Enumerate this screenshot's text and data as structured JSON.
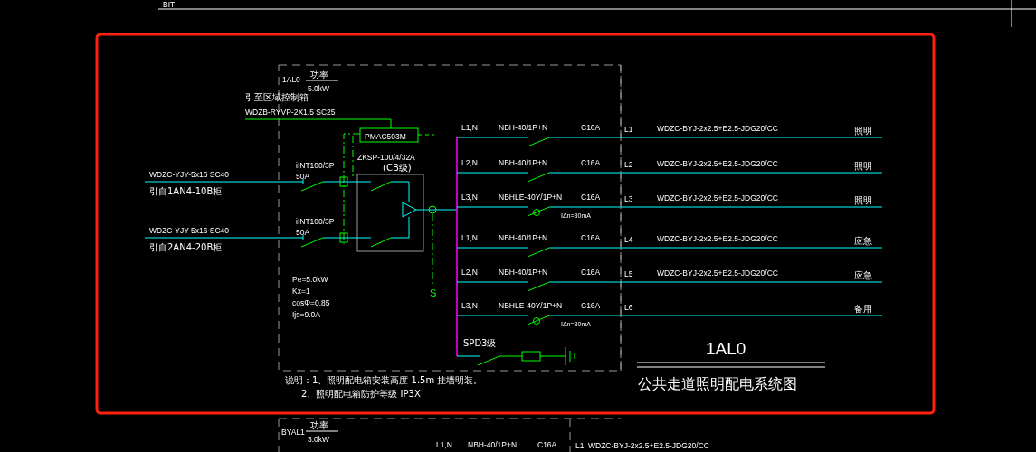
{
  "top_label": "BIT",
  "panel": {
    "name": "1AL0",
    "load_label": "功率",
    "load": "5.0kW",
    "control_note": "引至区域控制箱",
    "control_cable": "WDZB-RYVP-2X1.5 SC25",
    "meter": "PMAC503M",
    "ats": "ZKSP-100/4/32A",
    "ats_class": "(CB级)",
    "s_label": "S"
  },
  "inputs": [
    {
      "cable": "WDZC-YJY-5x16 SC40",
      "source": "引自1AN4-10B柜",
      "breaker": "iINT100/3P",
      "rating": "50A"
    },
    {
      "cable": "WDZC-YJY-5x16 SC40",
      "source": "引自2AN4-20B柜",
      "breaker": "iINT100/3P",
      "rating": "50A"
    }
  ],
  "circuits": [
    {
      "phase": "L1,N",
      "breaker": "NBH-40/1P+N",
      "rating": "C16A",
      "rcd": false,
      "line": "L1",
      "cable": "WDZC-BYJ-2x2.5+E2.5-JDG20/CC",
      "use": "照明"
    },
    {
      "phase": "L2,N",
      "breaker": "NBH-40/1P+N",
      "rating": "C16A",
      "rcd": false,
      "line": "L2",
      "cable": "WDZC-BYJ-2x2.5+E2.5-JDG20/CC",
      "use": "照明"
    },
    {
      "phase": "L3,N",
      "breaker": "NBHLE-40Y/1P+N",
      "rating": "C16A",
      "rcd": true,
      "rcd_label": "IΔn=30mA",
      "line": "L3",
      "cable": "WDZC-BYJ-2x2.5+E2.5-JDG20/CC",
      "use": "照明"
    },
    {
      "phase": "L1,N",
      "breaker": "NBH-40/1P+N",
      "rating": "C16A",
      "rcd": false,
      "line": "L4",
      "cable": "WDZC-BYJ-2x2.5+E2.5-JDG20/CC",
      "use": "应急"
    },
    {
      "phase": "L2,N",
      "breaker": "NBH-40/1P+N",
      "rating": "C16A",
      "rcd": false,
      "line": "L5",
      "cable": "WDZC-BYJ-2x2.5+E2.5-JDG20/CC",
      "use": "应急"
    },
    {
      "phase": "L3,N",
      "breaker": "NBHLE-40Y/1P+N",
      "rating": "C16A",
      "rcd": true,
      "rcd_label": "IΔn=30mA",
      "line": "L6",
      "use": "备用"
    }
  ],
  "spd": "SPD3级",
  "calc": [
    "Pe=5.0kW",
    "Kx=1",
    "cosΦ=0.85",
    "Ijs=9.0A"
  ],
  "notes": [
    "说明：1、照明配电箱安装高度 1.5m 挂墙明装。",
    "2、照明配电箱防护等级 IP3X"
  ],
  "title": {
    "code": "1AL0",
    "name": "公共走道照明配电系统图"
  },
  "next_panel": {
    "name": "BYAL1",
    "load_label": "功率",
    "load": "3.0kW",
    "phase": "L1,N",
    "breaker": "NBH-40/1P+N",
    "rating": "C16A",
    "line": "L1",
    "cable": "WDZC-BYJ-2x2.5+E2.5-JDG20/CC"
  }
}
